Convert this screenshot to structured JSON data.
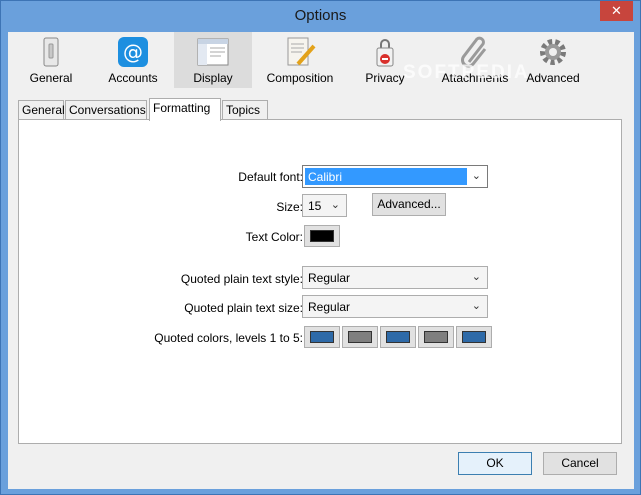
{
  "window": {
    "title": "Options",
    "close_glyph": "✕"
  },
  "toolbar": {
    "items": [
      {
        "label": "General",
        "icon": "switch-icon"
      },
      {
        "label": "Accounts",
        "icon": "at-icon"
      },
      {
        "label": "Display",
        "icon": "display-window-icon",
        "selected": true
      },
      {
        "label": "Composition",
        "icon": "paper-pen-icon"
      },
      {
        "label": "Privacy",
        "icon": "lock-tag-icon"
      },
      {
        "label": "Attachments",
        "icon": "paperclip-icon"
      },
      {
        "label": "Advanced",
        "icon": "gear-icon"
      }
    ],
    "watermark": "SOFTPEDIA"
  },
  "subtabs": [
    "General",
    "Conversations",
    "Formatting",
    "Topics"
  ],
  "active_subtab": "Formatting",
  "formatting": {
    "default_font_label": "Default font:",
    "default_font_value": "Calibri",
    "size_label": "Size:",
    "size_value": "15",
    "advanced_button": "Advanced...",
    "text_color_label": "Text Color:",
    "text_color_value": "#000000",
    "quoted_style_label": "Quoted plain text style:",
    "quoted_style_value": "Regular",
    "quoted_size_label": "Quoted plain text size:",
    "quoted_size_value": "Regular",
    "quoted_colors_label": "Quoted colors, levels 1 to 5:",
    "quoted_colors": [
      "#2e6aa8",
      "#7f7f7f",
      "#2e6aa8",
      "#7f7f7f",
      "#2e6aa8"
    ]
  },
  "footer": {
    "ok_label": "OK",
    "cancel_label": "Cancel"
  },
  "colors": {
    "titlebar": "#6aa0dc",
    "selection": "#3399ff"
  }
}
